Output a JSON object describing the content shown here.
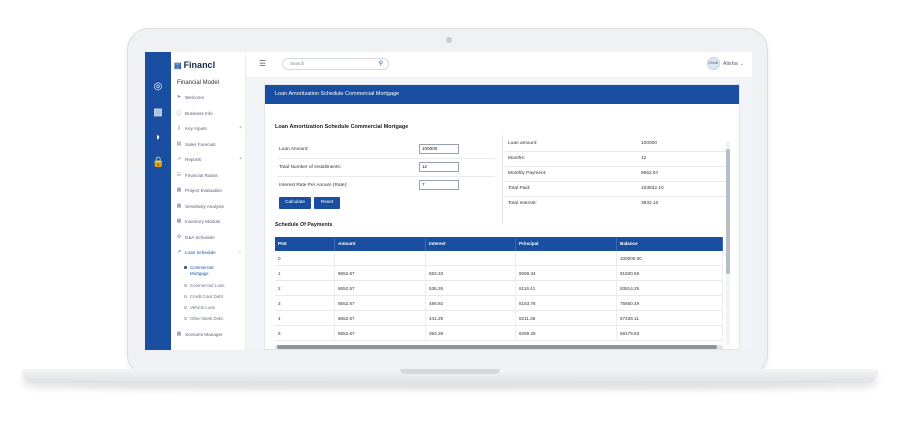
{
  "brand": {
    "logo_text": "Financl"
  },
  "sidebar": {
    "section_title": "Financial Model",
    "items": [
      {
        "label": "Welcome",
        "icon": "rocket-icon"
      },
      {
        "label": "Business Info",
        "icon": "info-icon"
      },
      {
        "label": "Key Inputs",
        "icon": "key-icon",
        "expandable": true
      },
      {
        "label": "Sales Forecast",
        "icon": "chart-icon"
      },
      {
        "label": "Reports",
        "icon": "trend-icon",
        "expandable": true
      },
      {
        "label": "Financial Ratios",
        "icon": "ratio-icon"
      },
      {
        "label": "Project Evaluation",
        "icon": "grid-icon"
      },
      {
        "label": "Sensitivity Analysis",
        "icon": "grid-icon"
      },
      {
        "label": "Inventory Module",
        "icon": "grid-icon"
      },
      {
        "label": "D&A Schedule",
        "icon": "settings-icon"
      },
      {
        "label": "Loan Schedule",
        "icon": "trend-icon",
        "expandable": true,
        "active": true
      },
      {
        "label": "Scenario Manager",
        "icon": "grid-icon"
      }
    ],
    "loan_subitems": [
      {
        "label_line1": "Commercial",
        "label_line2": "Mortgage",
        "active": true
      },
      {
        "label": "Commercial Loan"
      },
      {
        "label": "Credit Card Debt"
      },
      {
        "label": "Vehicle Loan"
      },
      {
        "label": "Other Bank Debt"
      }
    ]
  },
  "topbar": {
    "search_placeholder": "Search",
    "user_initials": "CN-W",
    "user_name": "Alisha"
  },
  "card": {
    "header_title": "Loan Amortization Schedule Commercial Mortgage",
    "section_title": "Loan Amortization Schedule Commercial Mortgage",
    "inputs": [
      {
        "label": "Loan Amount:",
        "value": "100000"
      },
      {
        "label": "Total Number of Installments:",
        "value": "12"
      },
      {
        "label": "Interest Rate Per Annum (Rate):",
        "value": "7"
      }
    ],
    "calculate_label": "Calculate",
    "reset_label": "Reset",
    "summary": [
      {
        "key": "Loan amount:",
        "value": "100000"
      },
      {
        "key": "Months:",
        "value": "12"
      },
      {
        "key": "Monthly Payment:",
        "value": "8652.67"
      },
      {
        "key": "Total Paid:",
        "value": "103832.10"
      },
      {
        "key": "Total Interest:",
        "value": "3832.10"
      }
    ],
    "schedule_title": "Schedule Of Payments",
    "table": {
      "headers": [
        "Pmt",
        "Amount",
        "Interest",
        "Principal",
        "Balance"
      ],
      "rows": [
        [
          "0",
          "",
          "",
          "",
          "100000.00"
        ],
        [
          "1",
          "8652.67",
          "583.33",
          "8069.34",
          "91930.66"
        ],
        [
          "2",
          "8652.67",
          "536.26",
          "8116.41",
          "83814.25"
        ],
        [
          "3",
          "8652.67",
          "488.92",
          "8163.76",
          "75650.49"
        ],
        [
          "4",
          "8652.67",
          "441.29",
          "8211.38",
          "67439.11"
        ],
        [
          "5",
          "8652.67",
          "393.39",
          "8259.28",
          "59179.83"
        ]
      ]
    }
  }
}
